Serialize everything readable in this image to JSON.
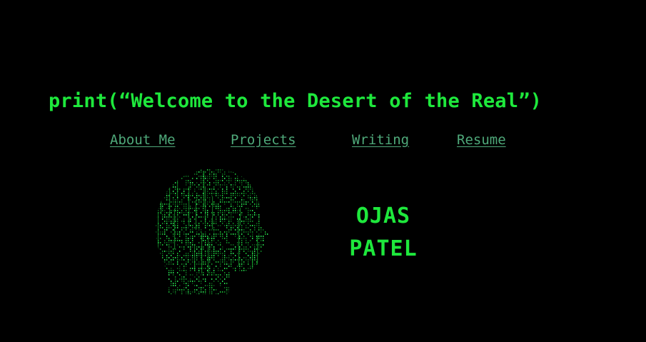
{
  "header": {
    "title": "print(“Welcome to the Desert of the Real”)"
  },
  "nav": {
    "items": [
      {
        "label": "About Me"
      },
      {
        "label": "Projects"
      },
      {
        "label": "Writing"
      },
      {
        "label": "Resume"
      }
    ]
  },
  "hero": {
    "portrait_icon": "matrix-code-head-silhouette",
    "name_first": "OJAS",
    "name_last": "PATEL"
  },
  "colors": {
    "background": "#000000",
    "accent_green": "#1ee83c",
    "link_green": "#4fa97a",
    "matrix_dim_green": "#0d6b1f"
  }
}
